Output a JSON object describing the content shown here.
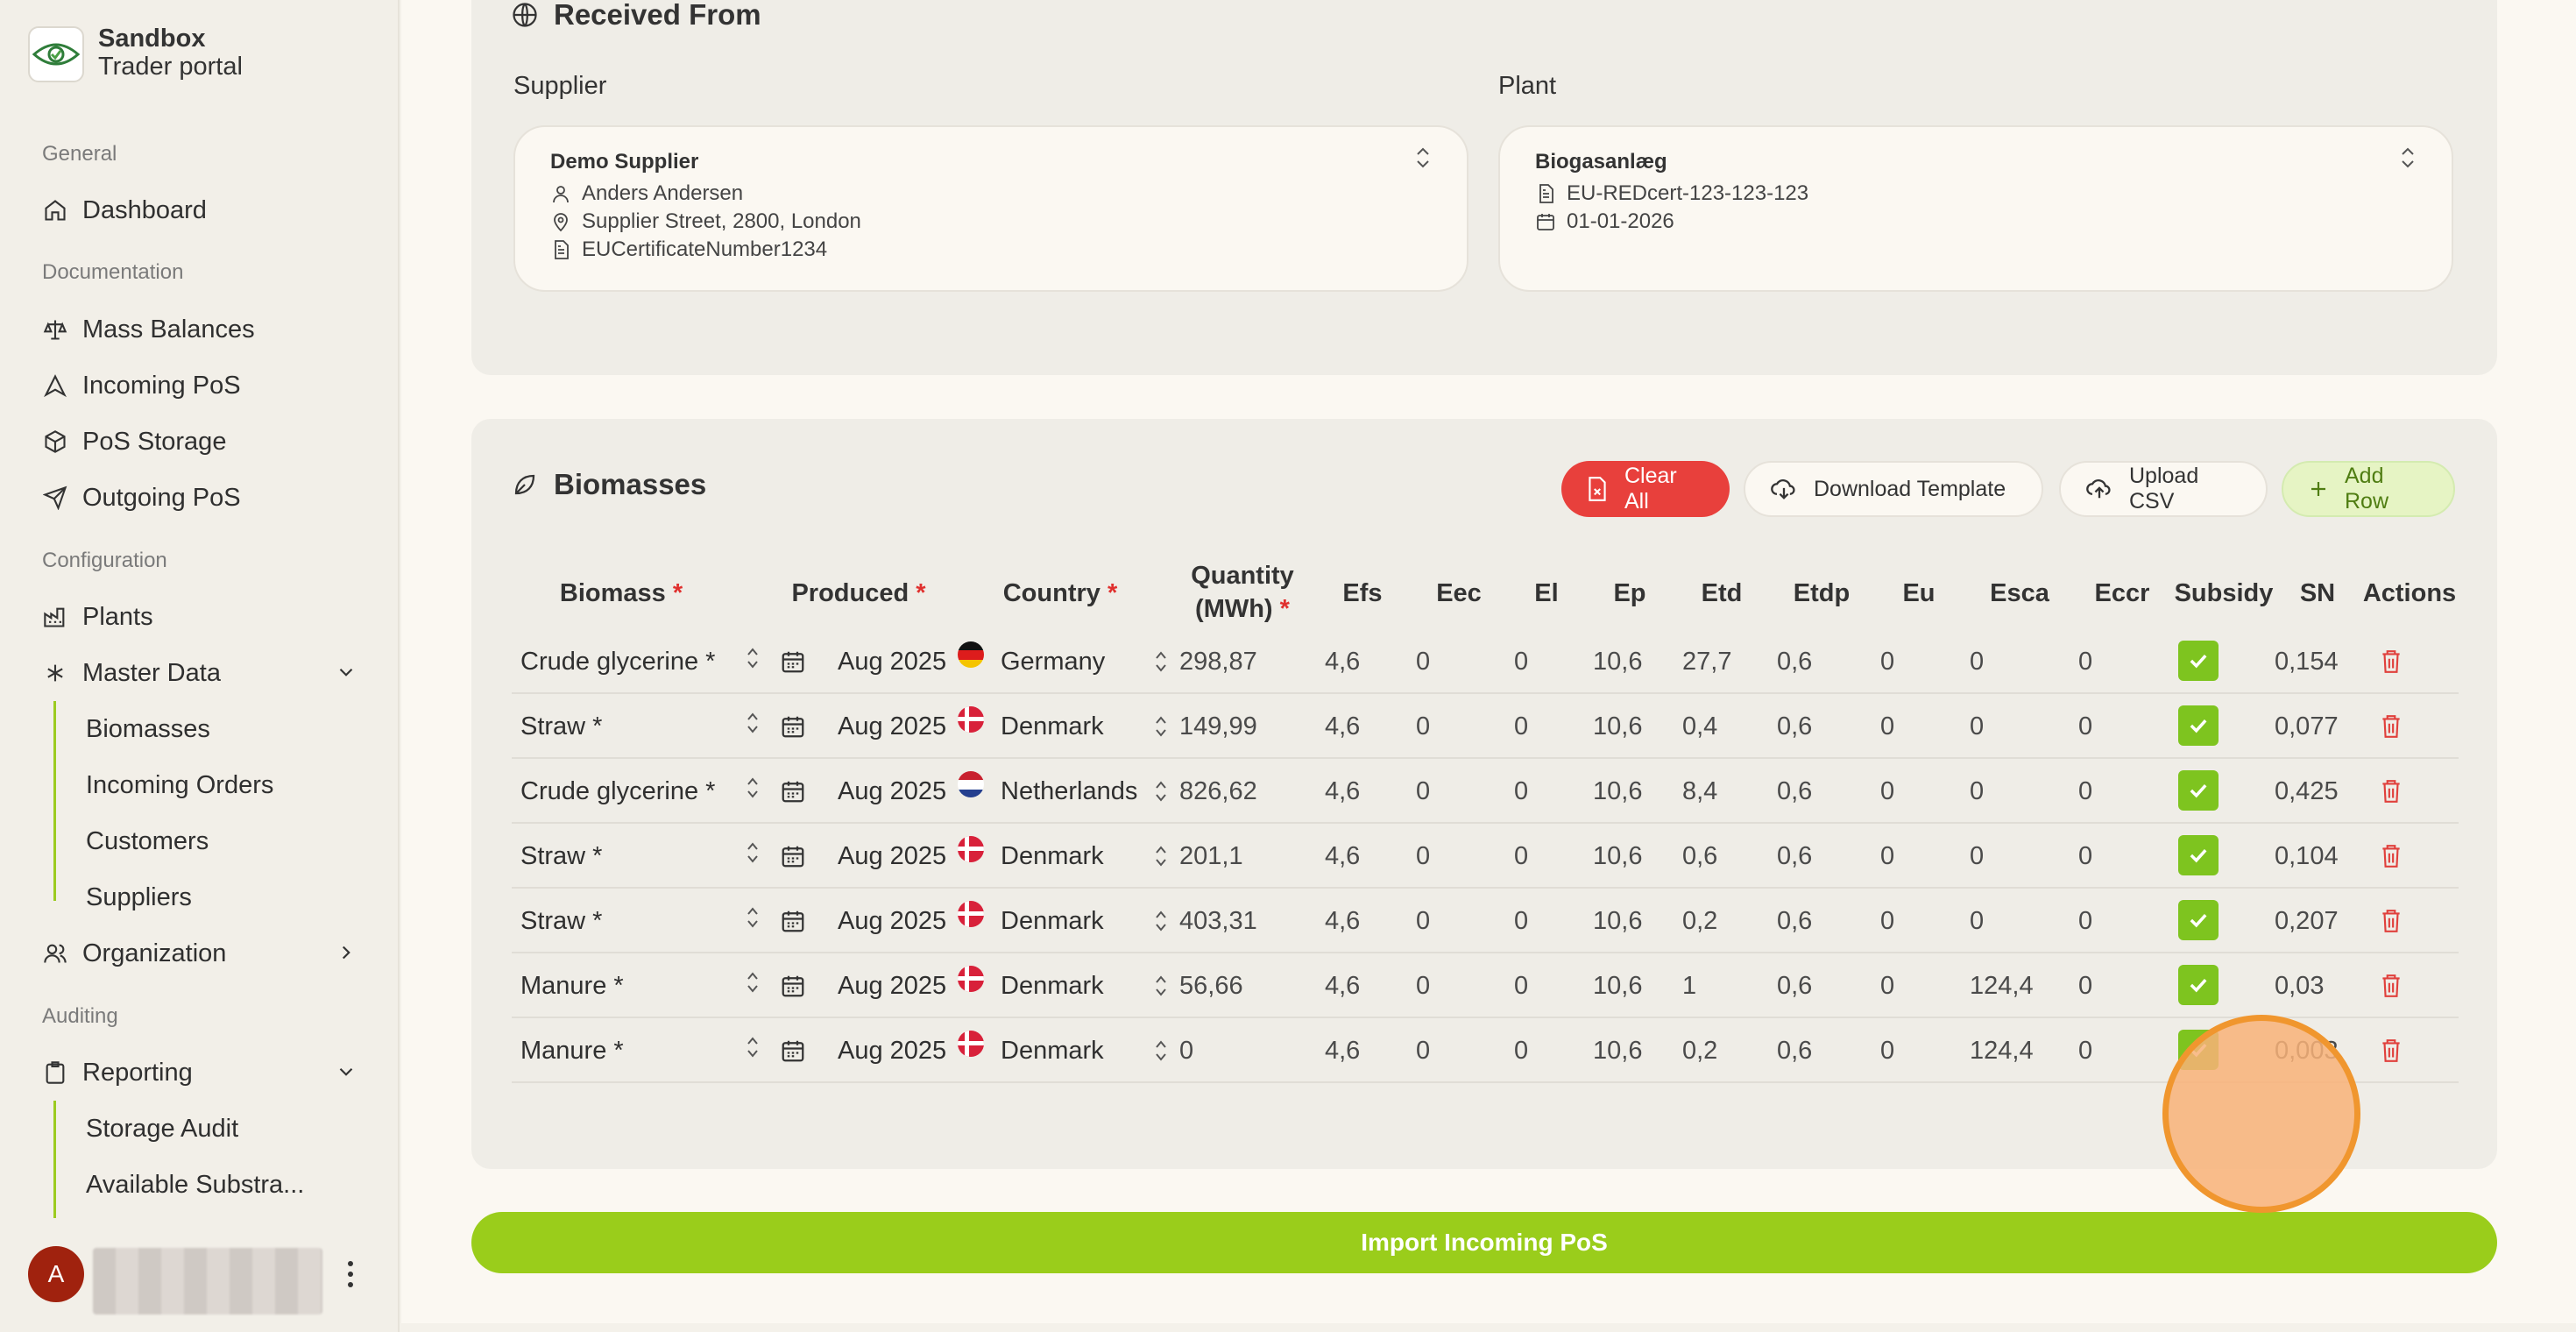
{
  "brand": {
    "line1": "Sandbox",
    "line2": "Trader portal"
  },
  "sidebar": {
    "sections": {
      "general": "General",
      "documentation": "Documentation",
      "configuration": "Configuration",
      "auditing": "Auditing"
    },
    "items": {
      "dashboard": "Dashboard",
      "mass_balances": "Mass Balances",
      "incoming_pos": "Incoming PoS",
      "pos_storage": "PoS Storage",
      "outgoing_pos": "Outgoing PoS",
      "plants": "Plants",
      "master_data": "Master Data",
      "biomasses": "Biomasses",
      "incoming_orders": "Incoming Orders",
      "customers": "Customers",
      "suppliers": "Suppliers",
      "organization": "Organization",
      "reporting": "Reporting",
      "storage_audit": "Storage Audit",
      "available_substrates": "Available Substra..."
    },
    "user_initial": "A"
  },
  "received_from": {
    "title": "Received From",
    "supplier_label": "Supplier",
    "plant_label": "Plant",
    "supplier": {
      "name": "Demo Supplier",
      "contact": "Anders Andersen",
      "address": "Supplier Street, 2800, London",
      "certificate": "EUCertificateNumber1234"
    },
    "plant": {
      "name": "Biogasanlæg",
      "certificate": "EU-REDcert-123-123-123",
      "date": "01-01-2026"
    }
  },
  "biomasses": {
    "title": "Biomasses",
    "buttons": {
      "clear_all": "Clear All",
      "download_template": "Download Template",
      "upload_csv": "Upload CSV",
      "add_row": "Add Row"
    },
    "headers": {
      "biomass": "Biomass",
      "produced": "Produced",
      "country": "Country",
      "quantity_line1": "Quantity",
      "quantity_line2": "(MWh)",
      "efs": "Efs",
      "eec": "Eec",
      "el": "El",
      "ep": "Ep",
      "etd": "Etd",
      "etdp": "Etdp",
      "eu": "Eu",
      "esca": "Esca",
      "eccr": "Eccr",
      "subsidy": "Subsidy",
      "sn": "SN",
      "actions": "Actions",
      "required_mark": "*"
    },
    "rows": [
      {
        "biomass": "Crude glycerine *",
        "produced": "Aug 2025",
        "flag": "de",
        "country": "Germany",
        "quantity": "298,87",
        "efs": "4,6",
        "eec": "0",
        "el": "0",
        "ep": "10,6",
        "etd": "27,7",
        "etdp": "0,6",
        "eu": "0",
        "esca": "0",
        "eccr": "0",
        "subsidy": true,
        "sn": "0,154"
      },
      {
        "biomass": "Straw *",
        "produced": "Aug 2025",
        "flag": "dk",
        "country": "Denmark",
        "quantity": "149,99",
        "efs": "4,6",
        "eec": "0",
        "el": "0",
        "ep": "10,6",
        "etd": "0,4",
        "etdp": "0,6",
        "eu": "0",
        "esca": "0",
        "eccr": "0",
        "subsidy": true,
        "sn": "0,077"
      },
      {
        "biomass": "Crude glycerine *",
        "produced": "Aug 2025",
        "flag": "nl",
        "country": "Netherlands",
        "quantity": "826,62",
        "efs": "4,6",
        "eec": "0",
        "el": "0",
        "ep": "10,6",
        "etd": "8,4",
        "etdp": "0,6",
        "eu": "0",
        "esca": "0",
        "eccr": "0",
        "subsidy": true,
        "sn": "0,425"
      },
      {
        "biomass": "Straw *",
        "produced": "Aug 2025",
        "flag": "dk",
        "country": "Denmark",
        "quantity": "201,1",
        "efs": "4,6",
        "eec": "0",
        "el": "0",
        "ep": "10,6",
        "etd": "0,6",
        "etdp": "0,6",
        "eu": "0",
        "esca": "0",
        "eccr": "0",
        "subsidy": true,
        "sn": "0,104"
      },
      {
        "biomass": "Straw *",
        "produced": "Aug 2025",
        "flag": "dk",
        "country": "Denmark",
        "quantity": "403,31",
        "efs": "4,6",
        "eec": "0",
        "el": "0",
        "ep": "10,6",
        "etd": "0,2",
        "etdp": "0,6",
        "eu": "0",
        "esca": "0",
        "eccr": "0",
        "subsidy": true,
        "sn": "0,207"
      },
      {
        "biomass": "Manure *",
        "produced": "Aug 2025",
        "flag": "dk",
        "country": "Denmark",
        "quantity": "56,66",
        "efs": "4,6",
        "eec": "0",
        "el": "0",
        "ep": "10,6",
        "etd": "1",
        "etdp": "0,6",
        "eu": "0",
        "esca": "124,4",
        "eccr": "0",
        "subsidy": true,
        "sn": "0,03"
      },
      {
        "biomass": "Manure *",
        "produced": "Aug 2025",
        "flag": "dk",
        "country": "Denmark",
        "quantity": "0",
        "efs": "4,6",
        "eec": "0",
        "el": "0",
        "ep": "10,6",
        "etd": "0,2",
        "etdp": "0,6",
        "eu": "0",
        "esca": "124,4",
        "eccr": "0",
        "subsidy": true,
        "sn": "0,003"
      }
    ]
  },
  "import_button": "Import Incoming PoS",
  "colors": {
    "accent_green": "#9acd1b",
    "danger_red": "#e8403c",
    "check_green": "#7ec41f"
  }
}
